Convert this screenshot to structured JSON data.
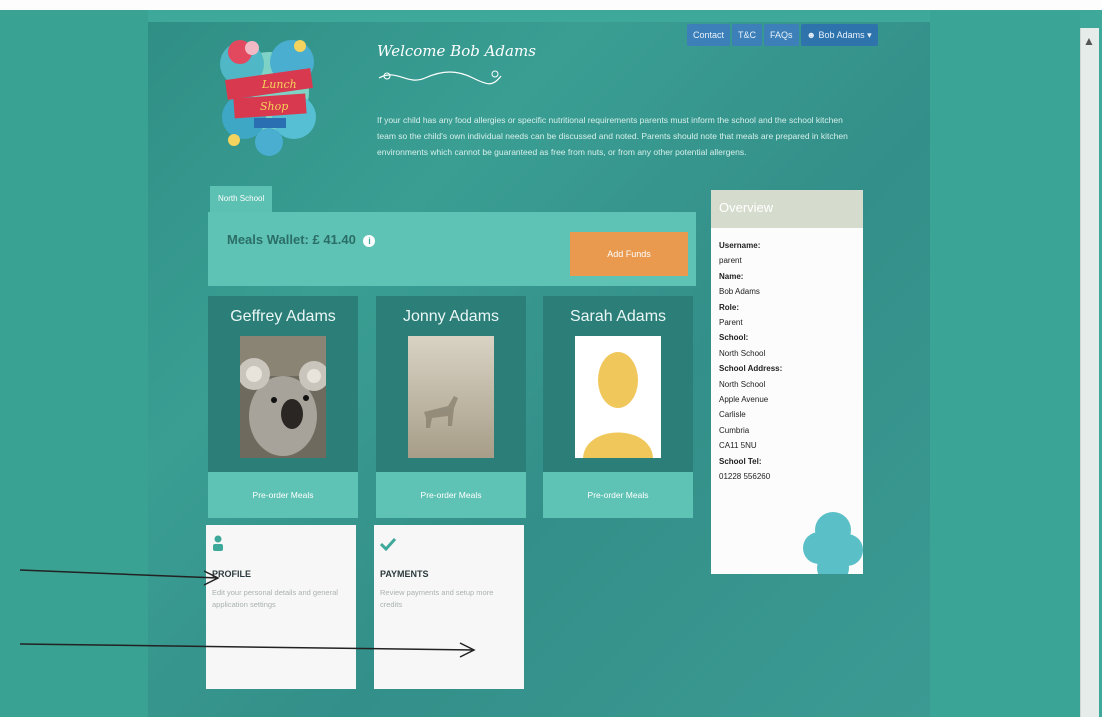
{
  "nav": {
    "contact": "Contact",
    "tandc": "T&C",
    "faqs": "FAQs",
    "user": "Bob Adams"
  },
  "welcome": "Welcome Bob Adams",
  "logo_text": {
    "line1": "Lunch",
    "line2": "Shop"
  },
  "intro_text": "If your child has any food allergies or specific nutritional requirements parents must inform the school and the school kitchen team so the child's own individual needs can be discussed and noted. Parents should note that meals are prepared in kitchen environments which cannot be guaranteed as free from nuts, or from any other potential allergens.",
  "school_tab": "North School",
  "wallet": {
    "label": "Meals Wallet: £ 41.40",
    "add_funds": "Add Funds"
  },
  "children": [
    {
      "name": "Geffrey Adams",
      "button": "Pre-order Meals",
      "photo": "koala"
    },
    {
      "name": "Jonny Adams",
      "button": "Pre-order Meals",
      "photo": "deer"
    },
    {
      "name": "Sarah Adams",
      "button": "Pre-order Meals",
      "photo": "placeholder"
    }
  ],
  "cards": [
    {
      "title": "PROFILE",
      "desc": "Edit your personal details and general application settings",
      "icon": "user-icon"
    },
    {
      "title": "PAYMENTS",
      "desc": "Review payments and setup more credits",
      "icon": "check-icon"
    }
  ],
  "overview": {
    "title": "Overview",
    "lines": [
      {
        "text": "Username:",
        "bold": true
      },
      {
        "text": "parent",
        "bold": false
      },
      {
        "text": "Name:",
        "bold": true
      },
      {
        "text": "Bob Adams",
        "bold": false
      },
      {
        "text": "Role:",
        "bold": true
      },
      {
        "text": "Parent",
        "bold": false
      },
      {
        "text": "School:",
        "bold": true
      },
      {
        "text": "North School",
        "bold": false
      },
      {
        "text": "School Address:",
        "bold": true
      },
      {
        "text": "North School",
        "bold": false
      },
      {
        "text": "Apple Avenue",
        "bold": false
      },
      {
        "text": "Carlisle",
        "bold": false
      },
      {
        "text": "Cumbria",
        "bold": false
      },
      {
        "text": "CA11 5NU",
        "bold": false
      },
      {
        "text": "School Tel:",
        "bold": true
      },
      {
        "text": "01228 556260",
        "bold": false
      }
    ]
  },
  "colors": {
    "page_bg": "#3ea99a",
    "accent_teal": "#5ec2b4",
    "dark_teal": "#2c7e79",
    "add_funds": "#e99a4f",
    "nav_blue": "#3d7fb8"
  }
}
